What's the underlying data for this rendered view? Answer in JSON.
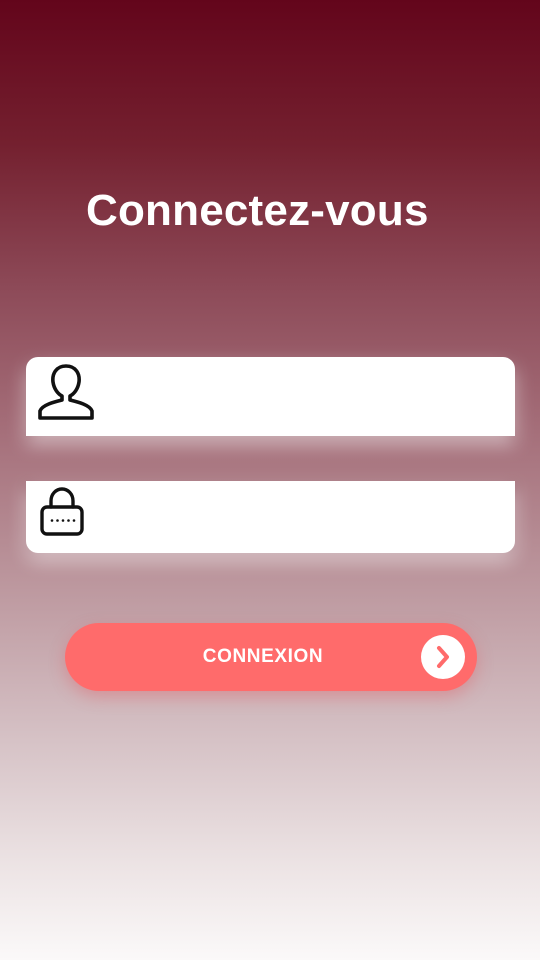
{
  "login": {
    "title": "Connectez-vous",
    "username": {
      "value": "",
      "placeholder": "",
      "icon": "user-icon"
    },
    "password": {
      "value": "",
      "placeholder": "",
      "icon": "lock-icon"
    },
    "submit": {
      "label": "CONNEXION",
      "icon": "chevron-right-icon"
    }
  },
  "colors": {
    "background_top": "#63051b",
    "background_bottom": "#fbf9f9",
    "button": "#ff6b6b",
    "title_text": "#ffffff",
    "field_background": "#ffffff",
    "icon_stroke": "#111111"
  }
}
